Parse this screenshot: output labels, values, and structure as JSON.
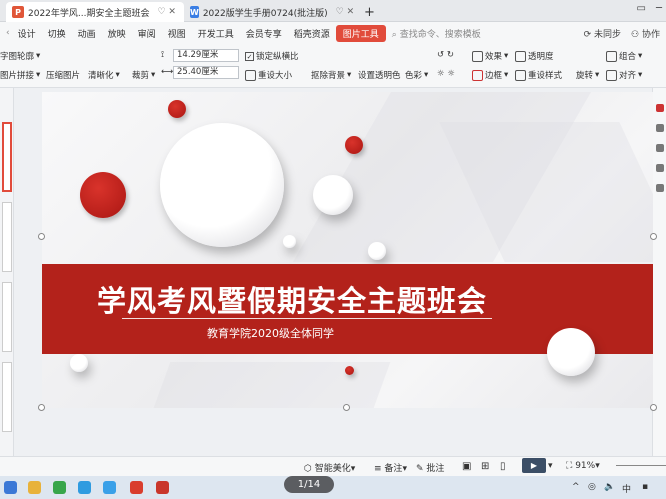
{
  "tabs": [
    {
      "label": "2022年学风...期安全主题班会",
      "icon": "P",
      "color": "#e05638",
      "actions": "♡ ✕"
    },
    {
      "label": "2022版学生手册0724(批注版)",
      "icon": "W",
      "color": "#3a7ee4",
      "actions": "♡ ✕"
    }
  ],
  "new_tab": "+",
  "ribbon": {
    "menu_tabs": [
      "设计",
      "切换",
      "动画",
      "放映",
      "审阅",
      "视图",
      "开发工具",
      "会员专享",
      "稻壳资源"
    ],
    "highlight_tab": "图片工具",
    "search": "查找命令、搜索模板",
    "sync": "未同步",
    "collab": "协作"
  },
  "toolbar": {
    "contour": "字图轮廓",
    "splice": "图片拼接",
    "compress": "压缩图片",
    "clarify": "清晰化",
    "crop": "裁剪",
    "height": "14.29厘米",
    "width": "25.40厘米",
    "lock_ratio": "锁定纵横比",
    "reset_size": "重设大小",
    "remove_bg": "抠除背景",
    "set_transparent": "设置透明色",
    "color": "色彩",
    "effect": "效果",
    "transparency": "透明度",
    "border": "边框",
    "reset_style": "重设样式",
    "rotate": "旋转",
    "group": "组合",
    "align": "对齐"
  },
  "slide": {
    "title": "学风考风暨假期安全主题班会",
    "subtitle": "教育学院2020级全体同学"
  },
  "status": {
    "beautify": "智能美化",
    "notes": "备注",
    "comment": "批注",
    "zoom": "91%",
    "page": "1/14"
  }
}
